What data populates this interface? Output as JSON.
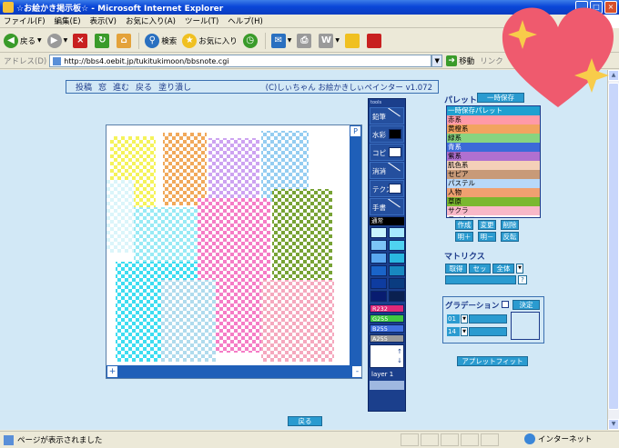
{
  "window": {
    "title": "☆お絵かき掲示板☆ - Microsoft Internet Explorer",
    "buttons": {
      "minimize": "_",
      "maximize": "□",
      "close": "×"
    }
  },
  "menu": [
    "ファイル(F)",
    "編集(E)",
    "表示(V)",
    "お気に入り(A)",
    "ツール(T)",
    "ヘルプ(H)"
  ],
  "toolbar": {
    "back": "戻る",
    "search": "検索",
    "favorites": "お気に入り"
  },
  "address": {
    "label": "アドレス(D)",
    "url": "http://bbs4.oebit.jp/tukitukimoon/bbsnote.cgi",
    "go": "移動",
    "links": "リンク"
  },
  "applet": {
    "nav": [
      "投稿",
      "窓",
      "進む",
      "戻る",
      "塗り潰し"
    ],
    "credit": "(C)しぃちゃん お絵かきしぃペインター v1.072",
    "canvas": {
      "corner_button": "P",
      "zoom_in": "+",
      "zoom_out": "-"
    }
  },
  "tools": {
    "caption": "tools",
    "items": [
      {
        "label": "鉛筆",
        "icon": "line-icon"
      },
      {
        "label": "水彩",
        "icon": "brush-icon"
      },
      {
        "label": "コピ",
        "icon": "copy-icon"
      },
      {
        "label": "消消",
        "icon": "eraser-icon"
      },
      {
        "label": "テクス",
        "icon": "texture-icon"
      },
      {
        "label": "手書",
        "icon": "handwrite-icon"
      }
    ],
    "mode": "通常",
    "swatches": [
      "#c8f4ff",
      "#a6e8ff",
      "#7cc4f6",
      "#4fd2f0",
      "#5aa8f0",
      "#2ab8e0",
      "#1a64c8",
      "#1888c0",
      "#0e3ca0",
      "#0a3c80",
      "#081c70",
      "#0a2050"
    ],
    "rgba": [
      {
        "label": "R232",
        "color": "#e02878"
      },
      {
        "label": "G255",
        "color": "#40c840"
      },
      {
        "label": "B255",
        "color": "#4070e0"
      },
      {
        "label": "A255",
        "color": "#9a9a9a"
      }
    ],
    "layer": "layer 1"
  },
  "palette": {
    "title": "パレット",
    "temp_save": "一時保存",
    "items": [
      {
        "label": "一時保存パレット",
        "color": "#1fa0d0",
        "text": "#ffffff"
      },
      {
        "label": "赤系",
        "color": "#ff9aa8",
        "text": "#000000"
      },
      {
        "label": "黄橙系",
        "color": "#f2a460",
        "text": "#000000"
      },
      {
        "label": "緑系",
        "color": "#88d480",
        "text": "#000000"
      },
      {
        "label": "青系",
        "color": "#3c6ad8",
        "text": "#ffffff"
      },
      {
        "label": "紫系",
        "color": "#b070d0",
        "text": "#000000"
      },
      {
        "label": "肌色系",
        "color": "#f4d0b8",
        "text": "#000000"
      },
      {
        "label": "セピア",
        "color": "#c89a78",
        "text": "#000000"
      },
      {
        "label": "パステル",
        "color": "#b8d8f8",
        "text": "#000000"
      },
      {
        "label": "人物",
        "color": "#f0a070",
        "text": "#000000"
      },
      {
        "label": "草原",
        "color": "#7ab830",
        "text": "#000000"
      },
      {
        "label": "サクラ",
        "color": "#f8b8c8",
        "text": "#000000"
      },
      {
        "label": "モノクロ",
        "color": "#ffffff",
        "text": "#000000"
      }
    ],
    "row1": [
      "作成",
      "変更",
      "削除"
    ],
    "row2": [
      "明＋",
      "明－",
      "反転"
    ]
  },
  "matrix": {
    "title": "マトリクス",
    "buttons": [
      "取得",
      "セット",
      "全体"
    ],
    "help": "?"
  },
  "gradation": {
    "title": "グラデーション",
    "ok": "決定",
    "row1": "01",
    "row2": "14"
  },
  "applet_fit": "アプレットフィット",
  "back_button": "戻る",
  "status": {
    "text": "ページが表示されました",
    "zone": "インターネット"
  },
  "colors": {
    "page_bg": "#d2e8f6",
    "applet_blue": "#1f5fb8",
    "accent": "#2a9bd0"
  }
}
